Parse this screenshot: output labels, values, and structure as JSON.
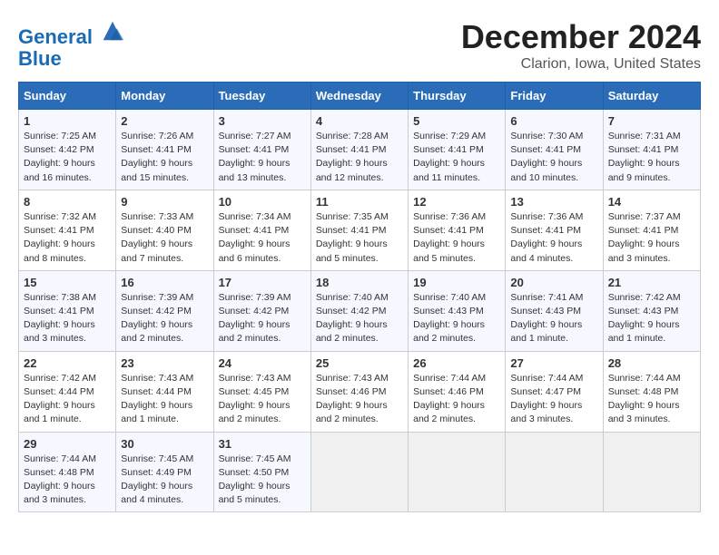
{
  "header": {
    "logo_line1": "General",
    "logo_line2": "Blue",
    "month": "December 2024",
    "location": "Clarion, Iowa, United States"
  },
  "weekdays": [
    "Sunday",
    "Monday",
    "Tuesday",
    "Wednesday",
    "Thursday",
    "Friday",
    "Saturday"
  ],
  "weeks": [
    [
      {
        "day": "1",
        "info": "Sunrise: 7:25 AM\nSunset: 4:42 PM\nDaylight: 9 hours and 16 minutes."
      },
      {
        "day": "2",
        "info": "Sunrise: 7:26 AM\nSunset: 4:41 PM\nDaylight: 9 hours and 15 minutes."
      },
      {
        "day": "3",
        "info": "Sunrise: 7:27 AM\nSunset: 4:41 PM\nDaylight: 9 hours and 13 minutes."
      },
      {
        "day": "4",
        "info": "Sunrise: 7:28 AM\nSunset: 4:41 PM\nDaylight: 9 hours and 12 minutes."
      },
      {
        "day": "5",
        "info": "Sunrise: 7:29 AM\nSunset: 4:41 PM\nDaylight: 9 hours and 11 minutes."
      },
      {
        "day": "6",
        "info": "Sunrise: 7:30 AM\nSunset: 4:41 PM\nDaylight: 9 hours and 10 minutes."
      },
      {
        "day": "7",
        "info": "Sunrise: 7:31 AM\nSunset: 4:41 PM\nDaylight: 9 hours and 9 minutes."
      }
    ],
    [
      {
        "day": "8",
        "info": "Sunrise: 7:32 AM\nSunset: 4:41 PM\nDaylight: 9 hours and 8 minutes."
      },
      {
        "day": "9",
        "info": "Sunrise: 7:33 AM\nSunset: 4:40 PM\nDaylight: 9 hours and 7 minutes."
      },
      {
        "day": "10",
        "info": "Sunrise: 7:34 AM\nSunset: 4:41 PM\nDaylight: 9 hours and 6 minutes."
      },
      {
        "day": "11",
        "info": "Sunrise: 7:35 AM\nSunset: 4:41 PM\nDaylight: 9 hours and 5 minutes."
      },
      {
        "day": "12",
        "info": "Sunrise: 7:36 AM\nSunset: 4:41 PM\nDaylight: 9 hours and 5 minutes."
      },
      {
        "day": "13",
        "info": "Sunrise: 7:36 AM\nSunset: 4:41 PM\nDaylight: 9 hours and 4 minutes."
      },
      {
        "day": "14",
        "info": "Sunrise: 7:37 AM\nSunset: 4:41 PM\nDaylight: 9 hours and 3 minutes."
      }
    ],
    [
      {
        "day": "15",
        "info": "Sunrise: 7:38 AM\nSunset: 4:41 PM\nDaylight: 9 hours and 3 minutes."
      },
      {
        "day": "16",
        "info": "Sunrise: 7:39 AM\nSunset: 4:42 PM\nDaylight: 9 hours and 2 minutes."
      },
      {
        "day": "17",
        "info": "Sunrise: 7:39 AM\nSunset: 4:42 PM\nDaylight: 9 hours and 2 minutes."
      },
      {
        "day": "18",
        "info": "Sunrise: 7:40 AM\nSunset: 4:42 PM\nDaylight: 9 hours and 2 minutes."
      },
      {
        "day": "19",
        "info": "Sunrise: 7:40 AM\nSunset: 4:43 PM\nDaylight: 9 hours and 2 minutes."
      },
      {
        "day": "20",
        "info": "Sunrise: 7:41 AM\nSunset: 4:43 PM\nDaylight: 9 hours and 1 minute."
      },
      {
        "day": "21",
        "info": "Sunrise: 7:42 AM\nSunset: 4:43 PM\nDaylight: 9 hours and 1 minute."
      }
    ],
    [
      {
        "day": "22",
        "info": "Sunrise: 7:42 AM\nSunset: 4:44 PM\nDaylight: 9 hours and 1 minute."
      },
      {
        "day": "23",
        "info": "Sunrise: 7:43 AM\nSunset: 4:44 PM\nDaylight: 9 hours and 1 minute."
      },
      {
        "day": "24",
        "info": "Sunrise: 7:43 AM\nSunset: 4:45 PM\nDaylight: 9 hours and 2 minutes."
      },
      {
        "day": "25",
        "info": "Sunrise: 7:43 AM\nSunset: 4:46 PM\nDaylight: 9 hours and 2 minutes."
      },
      {
        "day": "26",
        "info": "Sunrise: 7:44 AM\nSunset: 4:46 PM\nDaylight: 9 hours and 2 minutes."
      },
      {
        "day": "27",
        "info": "Sunrise: 7:44 AM\nSunset: 4:47 PM\nDaylight: 9 hours and 3 minutes."
      },
      {
        "day": "28",
        "info": "Sunrise: 7:44 AM\nSunset: 4:48 PM\nDaylight: 9 hours and 3 minutes."
      }
    ],
    [
      {
        "day": "29",
        "info": "Sunrise: 7:44 AM\nSunset: 4:48 PM\nDaylight: 9 hours and 3 minutes."
      },
      {
        "day": "30",
        "info": "Sunrise: 7:45 AM\nSunset: 4:49 PM\nDaylight: 9 hours and 4 minutes."
      },
      {
        "day": "31",
        "info": "Sunrise: 7:45 AM\nSunset: 4:50 PM\nDaylight: 9 hours and 5 minutes."
      },
      {
        "day": "",
        "info": ""
      },
      {
        "day": "",
        "info": ""
      },
      {
        "day": "",
        "info": ""
      },
      {
        "day": "",
        "info": ""
      }
    ]
  ]
}
